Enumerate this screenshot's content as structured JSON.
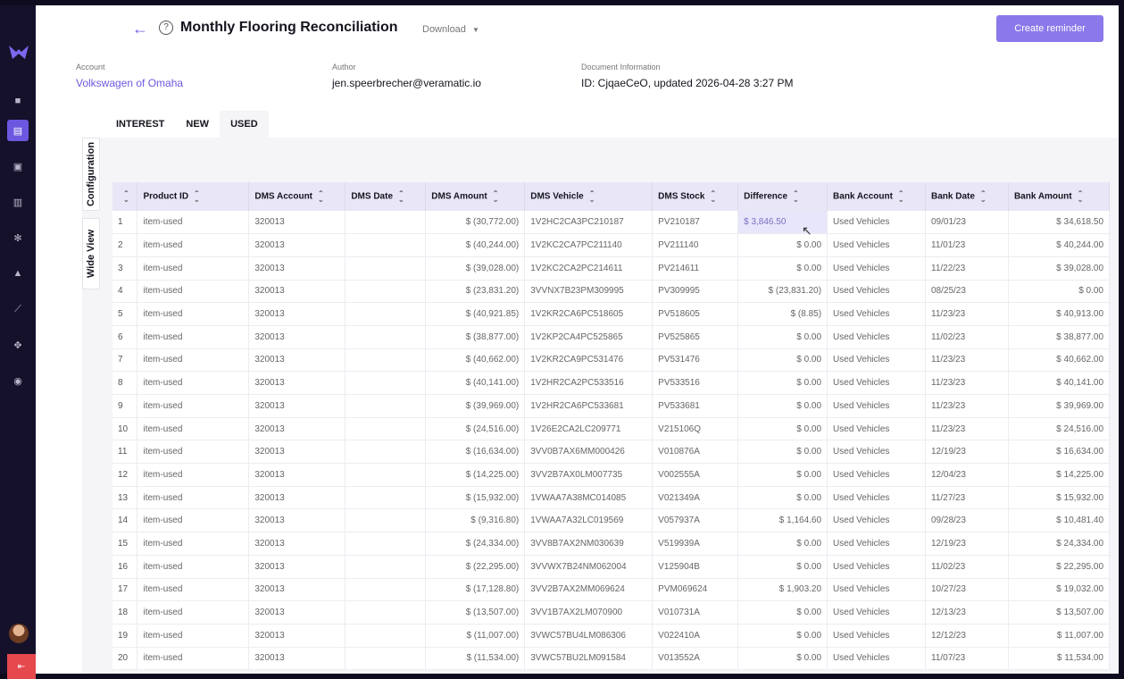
{
  "header": {
    "title": "Monthly Flooring Reconciliation",
    "download_label": "Download",
    "create_reminder_label": "Create reminder"
  },
  "meta": {
    "account_label": "Account",
    "account_value": "Volkswagen of Omaha",
    "author_label": "Author",
    "author_value": "jen.speerbrecher@veramatic.io",
    "doc_label": "Document Information",
    "doc_value": "ID: CjqaeCeO, updated 2026-04-28 3:27 PM"
  },
  "tabs": [
    "INTEREST",
    "NEW",
    "USED"
  ],
  "active_tab": "USED",
  "side_tabs": {
    "config": "Configuration",
    "wide": "Wide View"
  },
  "columns": [
    "Product ID",
    "DMS Account",
    "DMS Date",
    "DMS Amount",
    "DMS Vehicle",
    "DMS Stock",
    "Difference",
    "Bank Account",
    "Bank Date",
    "Bank Amount"
  ],
  "rows": [
    [
      "1",
      "item-used",
      "320013",
      "",
      "$ (30,772.00)",
      "1V2HC2CA3PC210187",
      "PV210187",
      "$ 3,846.50",
      "Used Vehicles",
      "09/01/23",
      "$ 34,618.50"
    ],
    [
      "2",
      "item-used",
      "320013",
      "",
      "$ (40,244.00)",
      "1V2KC2CA7PC211140",
      "PV211140",
      "$ 0.00",
      "Used Vehicles",
      "11/01/23",
      "$ 40,244.00"
    ],
    [
      "3",
      "item-used",
      "320013",
      "",
      "$ (39,028.00)",
      "1V2KC2CA2PC214611",
      "PV214611",
      "$ 0.00",
      "Used Vehicles",
      "11/22/23",
      "$ 39,028.00"
    ],
    [
      "4",
      "item-used",
      "320013",
      "",
      "$ (23,831.20)",
      "3VVNX7B23PM309995",
      "PV309995",
      "$ (23,831.20)",
      "Used Vehicles",
      "08/25/23",
      "$ 0.00"
    ],
    [
      "5",
      "item-used",
      "320013",
      "",
      "$ (40,921.85)",
      "1V2KR2CA6PC518605",
      "PV518605",
      "$ (8.85)",
      "Used Vehicles",
      "11/23/23",
      "$ 40,913.00"
    ],
    [
      "6",
      "item-used",
      "320013",
      "",
      "$ (38,877.00)",
      "1V2KP2CA4PC525865",
      "PV525865",
      "$ 0.00",
      "Used Vehicles",
      "11/02/23",
      "$ 38,877.00"
    ],
    [
      "7",
      "item-used",
      "320013",
      "",
      "$ (40,662.00)",
      "1V2KR2CA9PC531476",
      "PV531476",
      "$ 0.00",
      "Used Vehicles",
      "11/23/23",
      "$ 40,662.00"
    ],
    [
      "8",
      "item-used",
      "320013",
      "",
      "$ (40,141.00)",
      "1V2HR2CA2PC533516",
      "PV533516",
      "$ 0.00",
      "Used Vehicles",
      "11/23/23",
      "$ 40,141.00"
    ],
    [
      "9",
      "item-used",
      "320013",
      "",
      "$ (39,969.00)",
      "1V2HR2CA6PC533681",
      "PV533681",
      "$ 0.00",
      "Used Vehicles",
      "11/23/23",
      "$ 39,969.00"
    ],
    [
      "10",
      "item-used",
      "320013",
      "",
      "$ (24,516.00)",
      "1V26E2CA2LC209771",
      "V215106Q",
      "$ 0.00",
      "Used Vehicles",
      "11/23/23",
      "$ 24,516.00"
    ],
    [
      "11",
      "item-used",
      "320013",
      "",
      "$ (16,634.00)",
      "3VV0B7AX6MM000426",
      "V010876A",
      "$ 0.00",
      "Used Vehicles",
      "12/19/23",
      "$ 16,634.00"
    ],
    [
      "12",
      "item-used",
      "320013",
      "",
      "$ (14,225.00)",
      "3VV2B7AX0LM007735",
      "V002555A",
      "$ 0.00",
      "Used Vehicles",
      "12/04/23",
      "$ 14,225.00"
    ],
    [
      "13",
      "item-used",
      "320013",
      "",
      "$ (15,932.00)",
      "1VWAA7A38MC014085",
      "V021349A",
      "$ 0.00",
      "Used Vehicles",
      "11/27/23",
      "$ 15,932.00"
    ],
    [
      "14",
      "item-used",
      "320013",
      "",
      "$ (9,316.80)",
      "1VWAA7A32LC019569",
      "V057937A",
      "$ 1,164.60",
      "Used Vehicles",
      "09/28/23",
      "$ 10,481.40"
    ],
    [
      "15",
      "item-used",
      "320013",
      "",
      "$ (24,334.00)",
      "3VV8B7AX2NM030639",
      "V519939A",
      "$ 0.00",
      "Used Vehicles",
      "12/19/23",
      "$ 24,334.00"
    ],
    [
      "16",
      "item-used",
      "320013",
      "",
      "$ (22,295.00)",
      "3VVWX7B24NM062004",
      "V125904B",
      "$ 0.00",
      "Used Vehicles",
      "11/02/23",
      "$ 22,295.00"
    ],
    [
      "17",
      "item-used",
      "320013",
      "",
      "$ (17,128.80)",
      "3VV2B7AX2MM069624",
      "PVM069624",
      "$ 1,903.20",
      "Used Vehicles",
      "10/27/23",
      "$ 19,032.00"
    ],
    [
      "18",
      "item-used",
      "320013",
      "",
      "$ (13,507.00)",
      "3VV1B7AX2LM070900",
      "V010731A",
      "$ 0.00",
      "Used Vehicles",
      "12/13/23",
      "$ 13,507.00"
    ],
    [
      "19",
      "item-used",
      "320013",
      "",
      "$ (11,007.00)",
      "3VWC57BU4LM086306",
      "V022410A",
      "$ 0.00",
      "Used Vehicles",
      "12/12/23",
      "$ 11,007.00"
    ],
    [
      "20",
      "item-used",
      "320013",
      "",
      "$ (11,534.00)",
      "3VWC57BU2LM091584",
      "V013552A",
      "$ 0.00",
      "Used Vehicles",
      "11/07/23",
      "$ 11,534.00"
    ]
  ],
  "colors": {
    "accent": "#6b57e0",
    "sidebar": "#15112b",
    "header_row": "#e9e7f7"
  }
}
